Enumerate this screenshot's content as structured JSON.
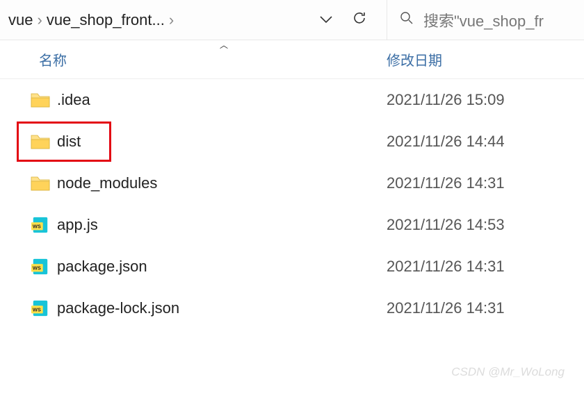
{
  "breadcrumb": {
    "items": [
      "vue",
      "vue_shop_front..."
    ]
  },
  "search": {
    "placeholder": "搜索\"vue_shop_fr"
  },
  "columns": {
    "name": "名称",
    "date": "修改日期"
  },
  "files": [
    {
      "name": ".idea",
      "date": "2021/11/26 15:09",
      "type": "folder"
    },
    {
      "name": "dist",
      "date": "2021/11/26 14:44",
      "type": "folder",
      "highlighted": true
    },
    {
      "name": "node_modules",
      "date": "2021/11/26 14:31",
      "type": "folder"
    },
    {
      "name": "app.js",
      "date": "2021/11/26 14:53",
      "type": "ws-file"
    },
    {
      "name": "package.json",
      "date": "2021/11/26 14:31",
      "type": "ws-file"
    },
    {
      "name": "package-lock.json",
      "date": "2021/11/26 14:31",
      "type": "ws-file"
    }
  ],
  "watermark": "CSDN @Mr_WoLong"
}
